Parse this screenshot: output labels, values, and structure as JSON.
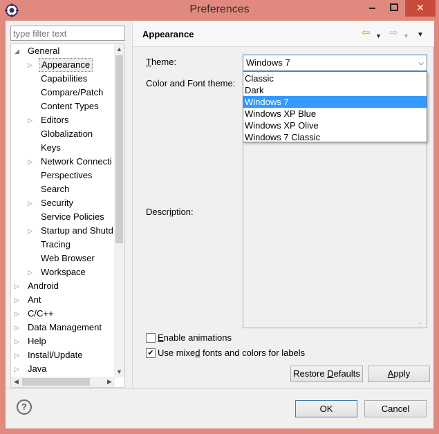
{
  "window": {
    "title": "Preferences",
    "close": "✕",
    "minimize": "–",
    "maximize": "☐"
  },
  "filter": {
    "placeholder": "type filter text"
  },
  "tree": [
    {
      "label": "General",
      "arrow": "◢",
      "indent": 0
    },
    {
      "label": "Appearance",
      "arrow": "▷",
      "indent": 1,
      "selected": true
    },
    {
      "label": "Capabilities",
      "arrow": "",
      "indent": 1
    },
    {
      "label": "Compare/Patch",
      "arrow": "",
      "indent": 1
    },
    {
      "label": "Content Types",
      "arrow": "",
      "indent": 1
    },
    {
      "label": "Editors",
      "arrow": "▷",
      "indent": 1
    },
    {
      "label": "Globalization",
      "arrow": "",
      "indent": 1
    },
    {
      "label": "Keys",
      "arrow": "",
      "indent": 1
    },
    {
      "label": "Network Connecti",
      "arrow": "▷",
      "indent": 1
    },
    {
      "label": "Perspectives",
      "arrow": "",
      "indent": 1
    },
    {
      "label": "Search",
      "arrow": "",
      "indent": 1
    },
    {
      "label": "Security",
      "arrow": "▷",
      "indent": 1
    },
    {
      "label": "Service Policies",
      "arrow": "",
      "indent": 1
    },
    {
      "label": "Startup and Shutd",
      "arrow": "▷",
      "indent": 1
    },
    {
      "label": "Tracing",
      "arrow": "",
      "indent": 1
    },
    {
      "label": "Web Browser",
      "arrow": "",
      "indent": 1
    },
    {
      "label": "Workspace",
      "arrow": "▷",
      "indent": 1
    },
    {
      "label": "Android",
      "arrow": "▷",
      "indent": 0
    },
    {
      "label": "Ant",
      "arrow": "▷",
      "indent": 0
    },
    {
      "label": "C/C++",
      "arrow": "▷",
      "indent": 0
    },
    {
      "label": "Data Management",
      "arrow": "▷",
      "indent": 0
    },
    {
      "label": "Help",
      "arrow": "▷",
      "indent": 0
    },
    {
      "label": "Install/Update",
      "arrow": "▷",
      "indent": 0
    },
    {
      "label": "Java",
      "arrow": "▷",
      "indent": 0
    }
  ],
  "page": {
    "title": "Appearance",
    "theme_label_first": "T",
    "theme_label_rest": "heme:",
    "color_label": "Color and Font theme:",
    "desc_label_a": "Descr",
    "desc_label_u": "i",
    "desc_label_b": "ption:",
    "theme_value": "Windows 7",
    "theme_options": [
      "Classic",
      "Dark",
      "Windows 7",
      "Windows XP Blue",
      "Windows XP Olive",
      "Windows 7 Classic"
    ],
    "theme_selected_index": 2,
    "enable_animations_u": "E",
    "enable_animations_rest": "nable animations",
    "enable_animations_checked": false,
    "mixed_fonts_a": "Use mixe",
    "mixed_fonts_u": "d",
    "mixed_fonts_b": " fonts and colors for labels",
    "mixed_fonts_checked": true,
    "restore_a": "Restore ",
    "restore_u": "D",
    "restore_b": "efaults",
    "apply_u": "A",
    "apply_rest": "pply"
  },
  "footer": {
    "help": "?",
    "ok": "OK",
    "cancel": "Cancel"
  },
  "colors": {
    "titlebar": "#e08a7f",
    "close": "#c84b3c",
    "selection": "#3399ff"
  }
}
